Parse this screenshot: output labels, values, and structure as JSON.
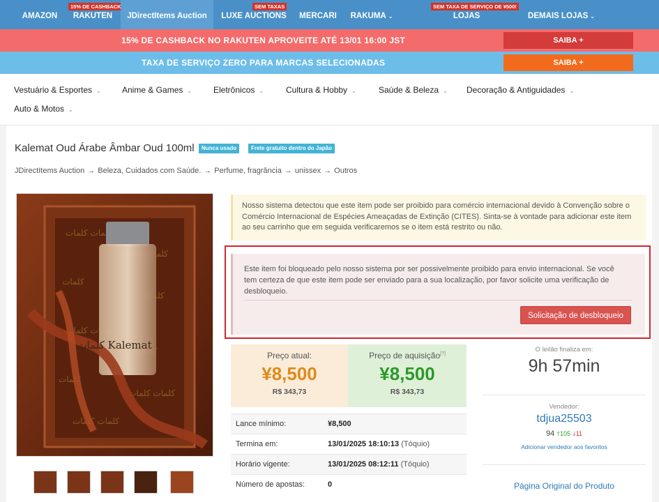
{
  "topnav": {
    "items": [
      {
        "label": "AMAZON"
      },
      {
        "label": "RAKUTEN",
        "badge": "15% DE CASHBACK!"
      },
      {
        "label": "JDirectItems Auction"
      },
      {
        "label": "LUXE AUCTIONS",
        "badge": "SEM TAXAS"
      },
      {
        "label": "MERCARI"
      },
      {
        "label": "RAKUMA"
      },
      {
        "label": "LOJAS RECOMENDADAS",
        "badge": "SEM TAXA DE SERVIÇO DE ¥500!"
      },
      {
        "label": "DEMAIS LOJAS"
      }
    ]
  },
  "promo": {
    "bar1_text": "15% DE CASHBACK NO RAKUTEN APROVEITE ATÉ 13/01 16:00 JST",
    "bar1_button": "SAIBA +",
    "bar2_text": "TAXA DE SERVIÇO ZERO PARA MARCAS SELECIONADAS",
    "bar2_button": "SAIBA +"
  },
  "categories": [
    "Vestuário & Esportes",
    "Anime & Games",
    "Eletrônicos",
    "Cultura & Hobby",
    "Saúde & Beleza",
    "Decoração & Antiguidades",
    "Auto & Motos"
  ],
  "product": {
    "title": "Kalemat Oud Árabe Âmbar Oud 100ml",
    "tags": [
      "Nunca usado",
      "Frete gratuito dentro do Japão"
    ],
    "breadcrumb": [
      "JDirectItems Auction",
      "Beleza, Cuidados com Saúde.",
      "Perfume, fragrância",
      "unissex",
      "Outros"
    ],
    "image_label": "كلمات Kalemat"
  },
  "notices": {
    "cites": "Nosso sistema detectou que este item pode ser proibido para comércio internacional devido à Convenção sobre o Comércio Internacional de Espécies Ameaçadas de Extinção (CITES). Sinta-se à vontade para adicionar este item ao seu carrinho que em seguida verificaremos se o item está restrito ou não.",
    "blocked": "Este item foi bloqueado pelo nosso sistema por ser possivelmente proibido para envio internacional. Se você tem certeza de que este item pode ser enviado para a sua localização, por favor solicite uma verificação de desbloqueio.",
    "unlock_button": "Solicitação de desbloqueio"
  },
  "prices": {
    "current_label": "Preço atual:",
    "current_value": "¥8,500",
    "current_brl": "R$ 343,73",
    "buyout_label": "Preço de aquisição",
    "buyout_help": "[?]",
    "buyout_value": "¥8,500",
    "buyout_brl": "R$ 343,73"
  },
  "details": [
    {
      "label": "Lance mínimo:",
      "value": "¥8,500",
      "suffix": ""
    },
    {
      "label": "Termina em:",
      "value": "13/01/2025 18:10:13",
      "suffix": "(Tóquio)"
    },
    {
      "label": "Horário vigente:",
      "value": "13/01/2025 08:12:11",
      "suffix": "(Tóquio)"
    },
    {
      "label": "Número de apostas:",
      "value": "0",
      "suffix": ""
    }
  ],
  "sidebar": {
    "ends_label": "O leilão finaliza em:",
    "time_left": "9h 57min",
    "seller_label": "Vendedor:",
    "seller_name": "tdjua25503",
    "rating": "94",
    "positive": "105",
    "negative": "11",
    "fav_link": "Adicionar vendedor aos favoritos",
    "original_link": "Página Original do Produto"
  },
  "colors": {
    "nav": "#4a90c8",
    "promo_red": "#f46b6b",
    "promo_blue": "#6dbde9",
    "price_orange": "#e08a1a",
    "price_green": "#2a9a2a",
    "alert_red": "#d0262a"
  }
}
